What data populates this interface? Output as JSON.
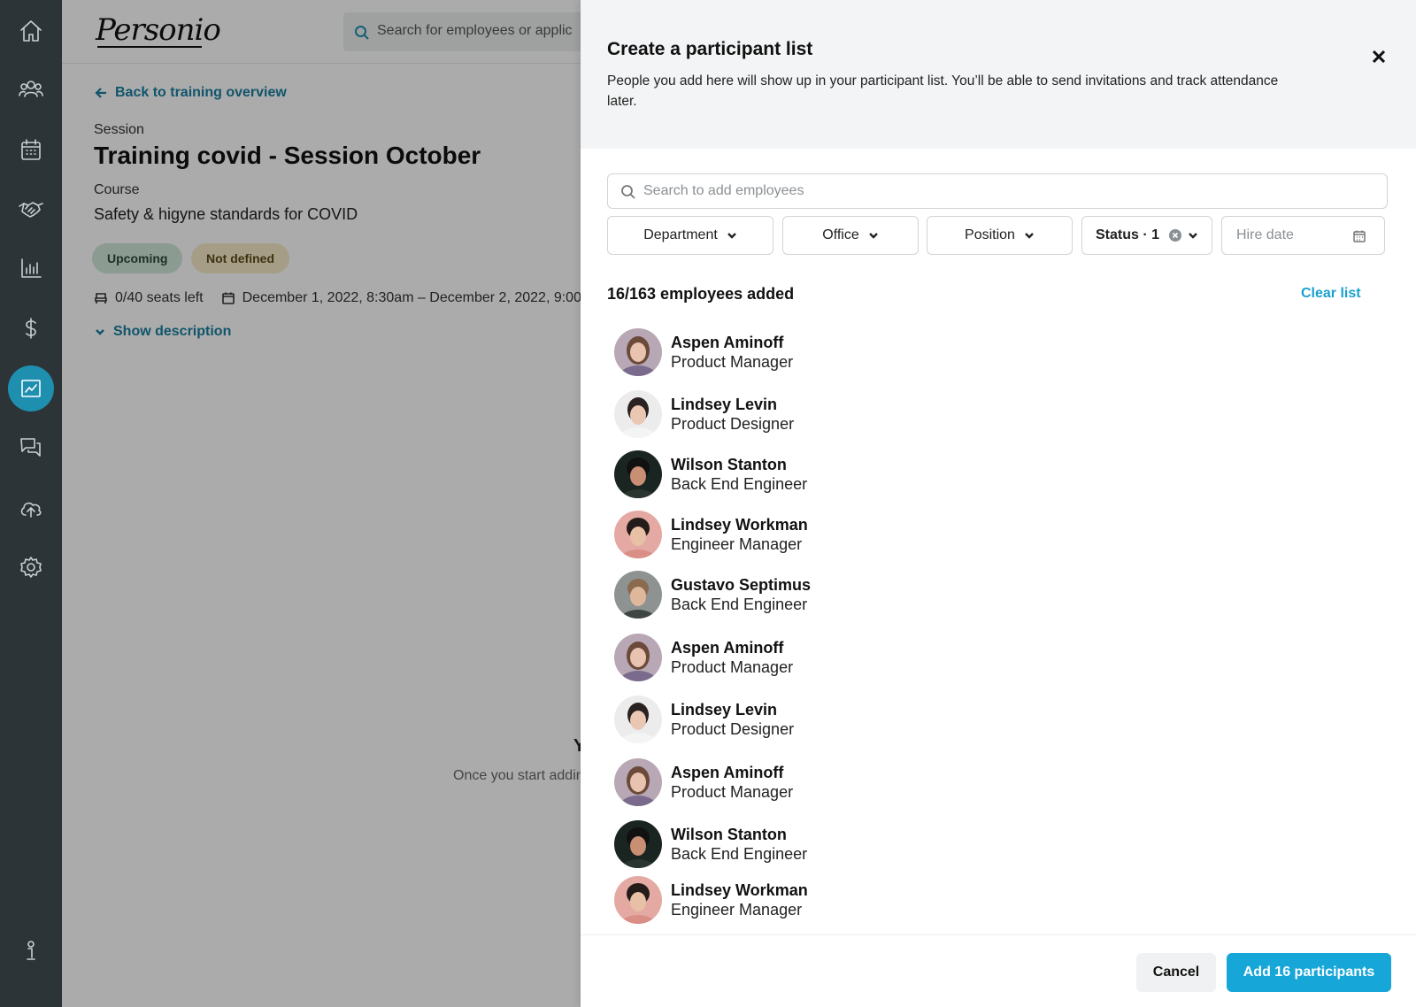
{
  "rail": {
    "items": [
      {
        "name": "home-icon",
        "active": false
      },
      {
        "name": "people-icon",
        "active": false
      },
      {
        "name": "calendar-icon",
        "active": false
      },
      {
        "name": "handshake-icon",
        "active": false
      },
      {
        "name": "analytics-icon",
        "active": false
      },
      {
        "name": "dollar-icon",
        "active": false
      },
      {
        "name": "performance-icon",
        "active": true
      },
      {
        "name": "chat-icon",
        "active": false
      },
      {
        "name": "cloud-upload-icon",
        "active": false
      },
      {
        "name": "gear-icon",
        "active": false
      },
      {
        "name": "info-icon",
        "active": false
      }
    ],
    "accent": "#1f8fb0"
  },
  "background_page": {
    "logo": "Personio",
    "search_placeholder": "Search for employees or applic",
    "back_link": "Back to training overview",
    "session_label": "Session",
    "session_title": "Training covid - Session October",
    "course_label": "Course",
    "course_name": "Safety & higyne standards for COVID",
    "badges": {
      "upcoming": "Upcoming",
      "not_defined": "Not defined"
    },
    "seats": "0/40 seats left",
    "dates": "December 1, 2022, 8:30am – December 2, 2022, 9:00",
    "show_description": "Show description",
    "empty_title": "Y",
    "empty_sub": "Once you start addin"
  },
  "drawer": {
    "title": "Create a participant list",
    "description": "People you add here will show up in your participant list. You’ll be able to send invitations and track attendance later.",
    "search_placeholder": "Search to add employees",
    "filters": {
      "department": "Department",
      "office": "Office",
      "position": "Position",
      "status": "Status · 1",
      "hire_date_placeholder": "Hire date"
    },
    "count": "16/163 employees added",
    "clear_list": "Clear list",
    "employees": [
      {
        "name": "Aspen Aminoff",
        "role": "Product Manager",
        "avatar": "a"
      },
      {
        "name": "Lindsey Levin",
        "role": "Product Designer",
        "avatar": "b"
      },
      {
        "name": "Wilson Stanton",
        "role": "Back End Engineer",
        "avatar": "c"
      },
      {
        "name": "Lindsey Workman",
        "role": "Engineer Manager",
        "avatar": "d"
      },
      {
        "name": "Gustavo Septimus",
        "role": "Back End Engineer",
        "avatar": "e"
      },
      {
        "name": "Aspen Aminoff",
        "role": "Product Manager",
        "avatar": "a"
      },
      {
        "name": "Lindsey Levin",
        "role": "Product Designer",
        "avatar": "b"
      },
      {
        "name": "Aspen Aminoff",
        "role": "Product Manager",
        "avatar": "a"
      },
      {
        "name": "Wilson Stanton",
        "role": "Back End Engineer",
        "avatar": "c"
      },
      {
        "name": "Lindsey Workman",
        "role": "Engineer Manager",
        "avatar": "d"
      }
    ],
    "cancel_label": "Cancel",
    "add_label": "Add 16 participants",
    "primary_color": "#17a6d8"
  }
}
